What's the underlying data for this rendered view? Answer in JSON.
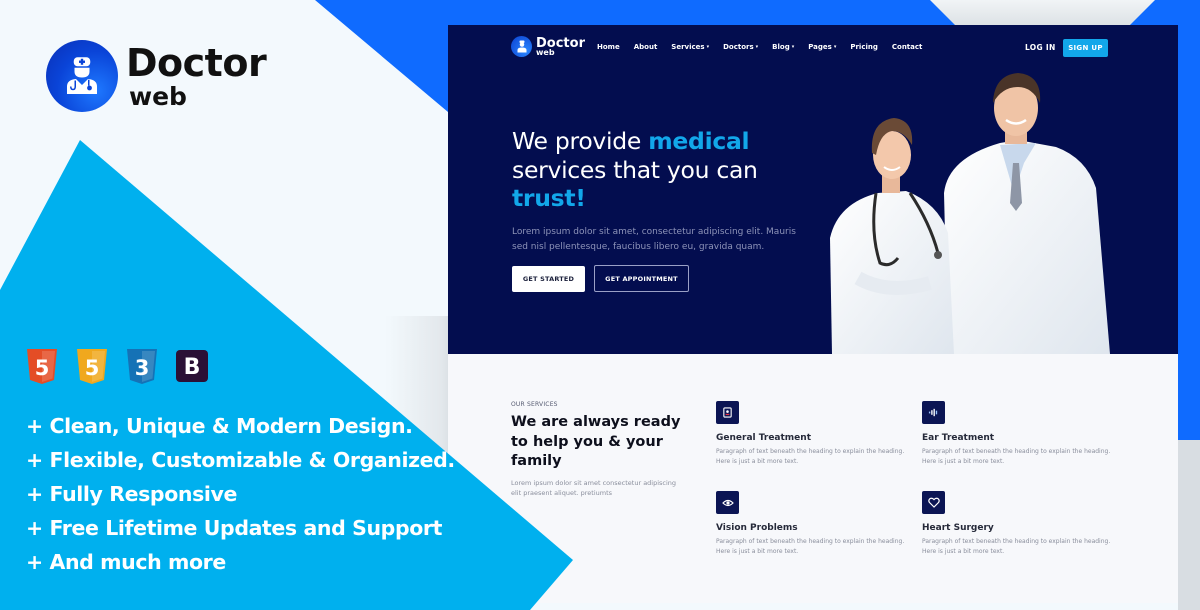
{
  "brand": {
    "name": "Doctor",
    "sub": "web",
    "logo_icon": "doctor-avatar-icon"
  },
  "colors": {
    "primary_blue": "#0f6bff",
    "sky_blue": "#00b0ee",
    "navy": "#030d4f",
    "accent": "#12a7ea"
  },
  "tech_icons": [
    {
      "name": "html5-icon",
      "label": "5",
      "color": "#e44d26"
    },
    {
      "name": "javascript-icon",
      "label": "5",
      "color": "#f0a81e"
    },
    {
      "name": "css3-icon",
      "label": "3",
      "color": "#1572b6"
    },
    {
      "name": "bootstrap-icon",
      "label": "B",
      "color": "#2b1035"
    }
  ],
  "features": [
    "+ Clean, Unique & Modern Design.",
    "+ Flexible, Customizable & Organized.",
    "+ Fully Responsive",
    "+ Free Lifetime Updates and Support",
    "+ And much more"
  ],
  "mockup": {
    "nav": {
      "brand_name": "Doctor",
      "brand_sub": "web",
      "links": [
        {
          "label": "Home",
          "dropdown": false
        },
        {
          "label": "About",
          "dropdown": false
        },
        {
          "label": "Services",
          "dropdown": true
        },
        {
          "label": "Doctors",
          "dropdown": true
        },
        {
          "label": "Blog",
          "dropdown": true
        },
        {
          "label": "Pages",
          "dropdown": true
        },
        {
          "label": "Pricing",
          "dropdown": false
        },
        {
          "label": "Contact",
          "dropdown": false
        }
      ],
      "caret": "▾",
      "login": "LOG IN",
      "signup": "SIGN UP"
    },
    "hero": {
      "title_part1": "We provide ",
      "title_accent1": "medical",
      "title_part2": "services that you can",
      "title_accent2": "trust!",
      "description": "Lorem ipsum dolor sit amet, consectetur adipiscing elit. Mauris sed nisl pellentesque, faucibus libero eu, gravida quam.",
      "btn_primary": "GET STARTED",
      "btn_secondary": "GET APPOINTMENT",
      "image": "two-doctors-photo"
    },
    "services": {
      "eyebrow": "OUR SERVICES",
      "title": "We are always ready to help you & your family",
      "description": "Lorem ipsum dolor sit amet consectetur adipiscing elit praesent aliquet. pretiumts",
      "cards": [
        {
          "title": "General Treatment",
          "text": "Paragraph of text beneath the heading to explain the heading. Here is just a bit more text.",
          "icon": "id-card-icon"
        },
        {
          "title": "Ear Treatment",
          "text": "Paragraph of text beneath the heading to explain the heading. Here is just a bit more text.",
          "icon": "sound-wave-icon"
        },
        {
          "title": "Vision Problems",
          "text": "Paragraph of text beneath the heading to explain the heading. Here is just a bit more text.",
          "icon": "eye-icon"
        },
        {
          "title": "Heart Surgery",
          "text": "Paragraph of text beneath the heading to explain the heading. Here is just a bit more text.",
          "icon": "heart-icon"
        }
      ]
    }
  }
}
